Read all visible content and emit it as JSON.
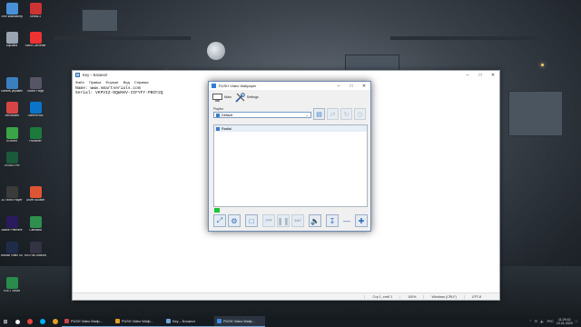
{
  "desktop": {
    "icons": [
      {
        "label": "Этот компьютер",
        "color": "#4a90d9"
      },
      {
        "label": "Корзина",
        "color": "#9aa5b1"
      },
      {
        "label": "Панель управления",
        "color": "#3c7fc1"
      },
      {
        "label": "Tenorshare",
        "color": "#d64545"
      },
      {
        "label": "Adobe Premiere",
        "color": "#2a1a5e"
      },
      {
        "label": "Movavi",
        "color": "#e04f5f"
      },
      {
        "label": "uTorrent",
        "color": "#3aa547"
      },
      {
        "label": "VEGAS Pro",
        "color": "#1a5a3a"
      },
      {
        "label": "3D Video Player",
        "color": "#3b3b3b"
      },
      {
        "label": "Photoshop CS6",
        "color": "#2a7bd6"
      },
      {
        "label": "Movavi Video Suite",
        "color": "#1e2c4a"
      },
      {
        "label": "ESET Smart",
        "color": "#2a8c4a"
      }
    ],
    "icons_right": [
      {
        "label": "Kerbal 3",
        "color": "#c33"
      },
      {
        "label": "Video Converter",
        "color": "#e33"
      },
      {
        "label": "Sound Forge",
        "color": "#556"
      },
      {
        "label": "ScreenFlow",
        "color": "#0a74c9"
      },
      {
        "label": "Publisher",
        "color": "#1b7a3c"
      },
      {
        "label": "Driver Booster",
        "color": "#d53"
      },
      {
        "label": "Camtasia",
        "color": "#2f8f4f"
      },
      {
        "label": "MSI Fan Android 7.1",
        "color": "#334"
      }
    ]
  },
  "notepad": {
    "title": "Key – Блокнот",
    "menu": [
      "Файл",
      "Правка",
      "Формат",
      "Вид",
      "Справка"
    ],
    "lines": [
      "Name: www.smartserials.com",
      "Serial: VKPVIZ-DQWAKV-IIFYFY-PBCF2Q"
    ],
    "status": [
      "Стр 1, стлб 1",
      "100%",
      "Windows (CRLF)",
      "UTF-8"
    ]
  },
  "push": {
    "title": "PUSH Video Wallpaper",
    "tabs": [
      "Main",
      "Settings"
    ],
    "playlist_label": "Playlist",
    "playlist_value": "Default",
    "items": [
      "Radial"
    ]
  },
  "taskbar": {
    "tasks": [
      {
        "label": "PUSH Video Wallp...",
        "color": "#c84545",
        "active": false
      },
      {
        "label": "PUSH Video Wallp...",
        "color": "#e0a020",
        "active": false
      },
      {
        "label": "Key – Блокнот",
        "color": "#6ea6d8",
        "active": false
      },
      {
        "label": "PUSH Video Wallp...",
        "color": "#3f8de0",
        "active": true
      }
    ],
    "lang": "РУС",
    "time": "11:29:42",
    "date": "10.01.2020"
  }
}
